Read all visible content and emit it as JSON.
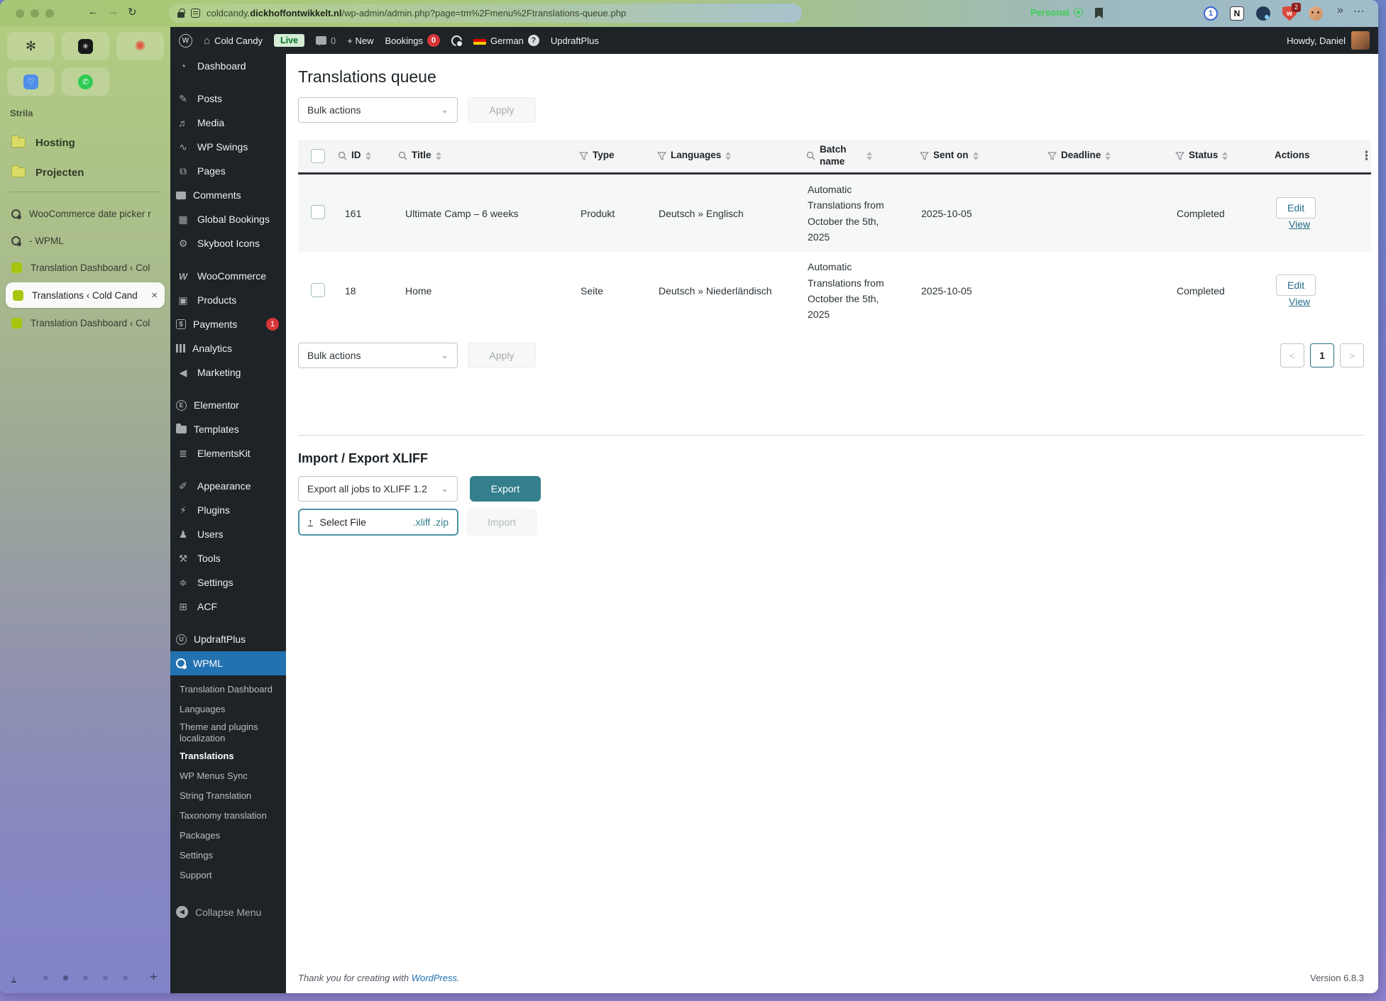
{
  "colors": {
    "accent": "#2271b1",
    "wpml_teal": "#347f8d",
    "badge_red": "#d63638",
    "live_green": "#00731f"
  },
  "browser": {
    "url_site": "coldcandy.",
    "url_domain": "dickhoffontwikkelt.nl",
    "url_path": "/wp-admin/admin.php?page=tm%2Fmenu%2Ftranslations-queue.php",
    "profile_label": "Personal",
    "extension_1password": "1",
    "extension_notion": "N",
    "extension_shield_letter": "w",
    "extension_shield_badge": "2",
    "more_chevrons": "»",
    "more_dots": "⋯",
    "back": "←",
    "forward": "→",
    "reload": "↻"
  },
  "arc": {
    "workspace": "Strila",
    "folders": [
      {
        "label": "Hosting"
      },
      {
        "label": "Projecten"
      }
    ],
    "tabs": [
      {
        "label": "WooCommerce date picker r",
        "icon": "wpml-favicon"
      },
      {
        "label": "- WPML",
        "icon": "wpml-favicon"
      },
      {
        "label": "Translation Dashboard ‹ Col",
        "icon": "site-favicon"
      },
      {
        "label": "Translations ‹ Cold Cand",
        "icon": "site-favicon",
        "active": true,
        "close": "×"
      },
      {
        "label": "Translation Dashboard ‹ Col",
        "icon": "site-favicon"
      }
    ],
    "new_tab": "+",
    "download": "↓",
    "dot_count": 5,
    "active_dot": 2
  },
  "admin_bar": {
    "wp": "W",
    "site_name": "Cold Candy",
    "live_badge": "Live",
    "comment_count": "0",
    "new_label": "+ New",
    "bookings_label": "Bookings",
    "bookings_count": "0",
    "language": "German",
    "help_badge": "?",
    "updraft": "UpdraftPlus",
    "howdy": "Howdy, Daniel"
  },
  "wp_menu": {
    "items": [
      {
        "label": "Dashboard",
        "icon": "dashboard-icon"
      },
      {
        "label": "Posts",
        "icon": "posts-icon",
        "group": true
      },
      {
        "label": "Media",
        "icon": "media-icon"
      },
      {
        "label": "WP Swings",
        "icon": "wpswings-icon"
      },
      {
        "label": "Pages",
        "icon": "pages-icon"
      },
      {
        "label": "Comments",
        "icon": "comments-icon"
      },
      {
        "label": "Global Bookings",
        "icon": "bookings-icon"
      },
      {
        "label": "Skyboot Icons",
        "icon": "skyboot-icon"
      },
      {
        "label": "WooCommerce",
        "icon": "woocommerce-icon",
        "group": true
      },
      {
        "label": "Products",
        "icon": "products-icon"
      },
      {
        "label": "Payments",
        "icon": "payments-icon",
        "badge": "1"
      },
      {
        "label": "Analytics",
        "icon": "analytics-icon"
      },
      {
        "label": "Marketing",
        "icon": "marketing-icon"
      },
      {
        "label": "Elementor",
        "icon": "elementor-icon",
        "group": true
      },
      {
        "label": "Templates",
        "icon": "templates-icon"
      },
      {
        "label": "ElementsKit",
        "icon": "elementskit-icon"
      },
      {
        "label": "Appearance",
        "icon": "appearance-icon",
        "group": true
      },
      {
        "label": "Plugins",
        "icon": "plugins-icon"
      },
      {
        "label": "Users",
        "icon": "users-icon"
      },
      {
        "label": "Tools",
        "icon": "tools-icon"
      },
      {
        "label": "Settings",
        "icon": "settings-icon"
      },
      {
        "label": "ACF",
        "icon": "acf-icon"
      },
      {
        "label": "UpdraftPlus",
        "icon": "updraft-icon",
        "group": true
      },
      {
        "label": "WPML",
        "icon": "wpml-icon",
        "active": true
      }
    ],
    "wpml_submenu": [
      {
        "label": "Translation Dashboard"
      },
      {
        "label": "Languages"
      },
      {
        "label": "Theme and plugins localization"
      },
      {
        "label": "Translations",
        "active": true
      },
      {
        "label": "WP Menus Sync"
      },
      {
        "label": "String Translation"
      },
      {
        "label": "Taxonomy translation"
      },
      {
        "label": "Packages"
      },
      {
        "label": "Settings"
      },
      {
        "label": "Support"
      }
    ],
    "collapse": "Collapse Menu"
  },
  "page": {
    "title": "Translations queue",
    "bulk_actions": "Bulk actions",
    "apply": "Apply",
    "table": {
      "headers": [
        "ID",
        "Title",
        "Type",
        "Languages",
        "Batch name",
        "Sent on",
        "Deadline",
        "Status",
        "Actions"
      ],
      "rows": [
        {
          "id": "161",
          "title": "Ultimate Camp – 6 weeks",
          "type": "Produkt",
          "languages": "Deutsch » Englisch",
          "batch": "Automatic Translations from October the 5th, 2025",
          "sent_on": "2025-10-05",
          "deadline": "",
          "status": "Completed"
        },
        {
          "id": "18",
          "title": "Home",
          "type": "Seite",
          "languages": "Deutsch » Niederländisch",
          "batch": "Automatic Translations from October the 5th, 2025",
          "sent_on": "2025-10-05",
          "deadline": "",
          "status": "Completed"
        }
      ],
      "actions": {
        "edit": "Edit",
        "view": "View"
      }
    },
    "pagination": {
      "prev": "<",
      "current": "1",
      "next": ">"
    },
    "import_export": {
      "title": "Import / Export XLIFF",
      "export_select": "Export all jobs to XLIFF 1.2",
      "export_button": "Export",
      "select_file": "Select File",
      "file_types": ".xliff .zip",
      "import_button": "Import"
    },
    "footer": {
      "thanks_prefix": "Thank you for creating with ",
      "link": "WordPress",
      "suffix": ".",
      "version": "Version 6.8.3"
    }
  }
}
